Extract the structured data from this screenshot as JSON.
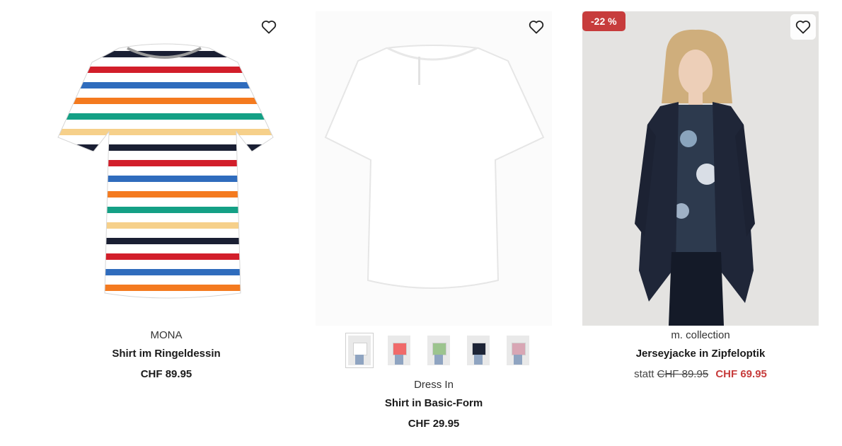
{
  "products": [
    {
      "brand": "MONA",
      "name": "Shirt im Ringeldessin",
      "price": "CHF 89.95",
      "wishlist_icon": "heart-outline-icon"
    },
    {
      "brand": "Dress In",
      "name": "Shirt in Basic-Form",
      "price": "CHF 29.95",
      "wishlist_icon": "heart-outline-icon",
      "thumbnails": [
        {
          "color": "#ffffff",
          "label": "white"
        },
        {
          "color": "#f06a6a",
          "label": "coral"
        },
        {
          "color": "#9cc48e",
          "label": "green"
        },
        {
          "color": "#1d2436",
          "label": "navy"
        },
        {
          "color": "#d8a6b4",
          "label": "rose"
        }
      ]
    },
    {
      "brand": "m. collection",
      "name": "Jerseyjacke in Zipfeloptik",
      "discount_badge": "-22 %",
      "statt_label": "statt",
      "old_price": "CHF 89.95",
      "sale_price": "CHF 69.95",
      "wishlist_icon": "heart-outline-icon"
    }
  ],
  "colors": {
    "sale": "#c73c3c",
    "text": "#1a1a1a"
  }
}
